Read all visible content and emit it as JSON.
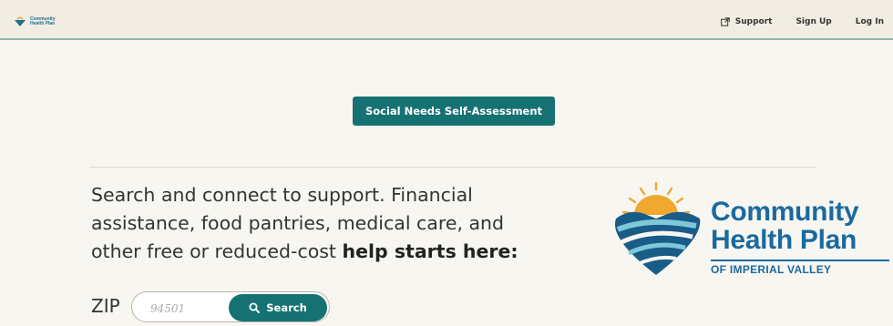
{
  "header": {
    "logo_alt": "Community Health Plan",
    "nav": {
      "support": "Support",
      "signup": "Sign Up",
      "login": "Log In"
    }
  },
  "cta": {
    "label": "Social Needs Self-Assessment"
  },
  "hero": {
    "line1": "Search and connect to support. Financial",
    "line2": "assistance, food pantries, medical care, and",
    "line3_prefix": "other free or reduced-cost ",
    "line3_bold": "help starts here:"
  },
  "search": {
    "zip_label": "ZIP",
    "zip_placeholder": "94501",
    "button_label": "Search"
  },
  "brand": {
    "line1": "Community",
    "line2": "Health Plan",
    "line3": "OF IMPERIAL VALLEY"
  },
  "colors": {
    "teal": "#167272",
    "brand_blue": "#1a6aa0",
    "sun": "#f0a830"
  }
}
